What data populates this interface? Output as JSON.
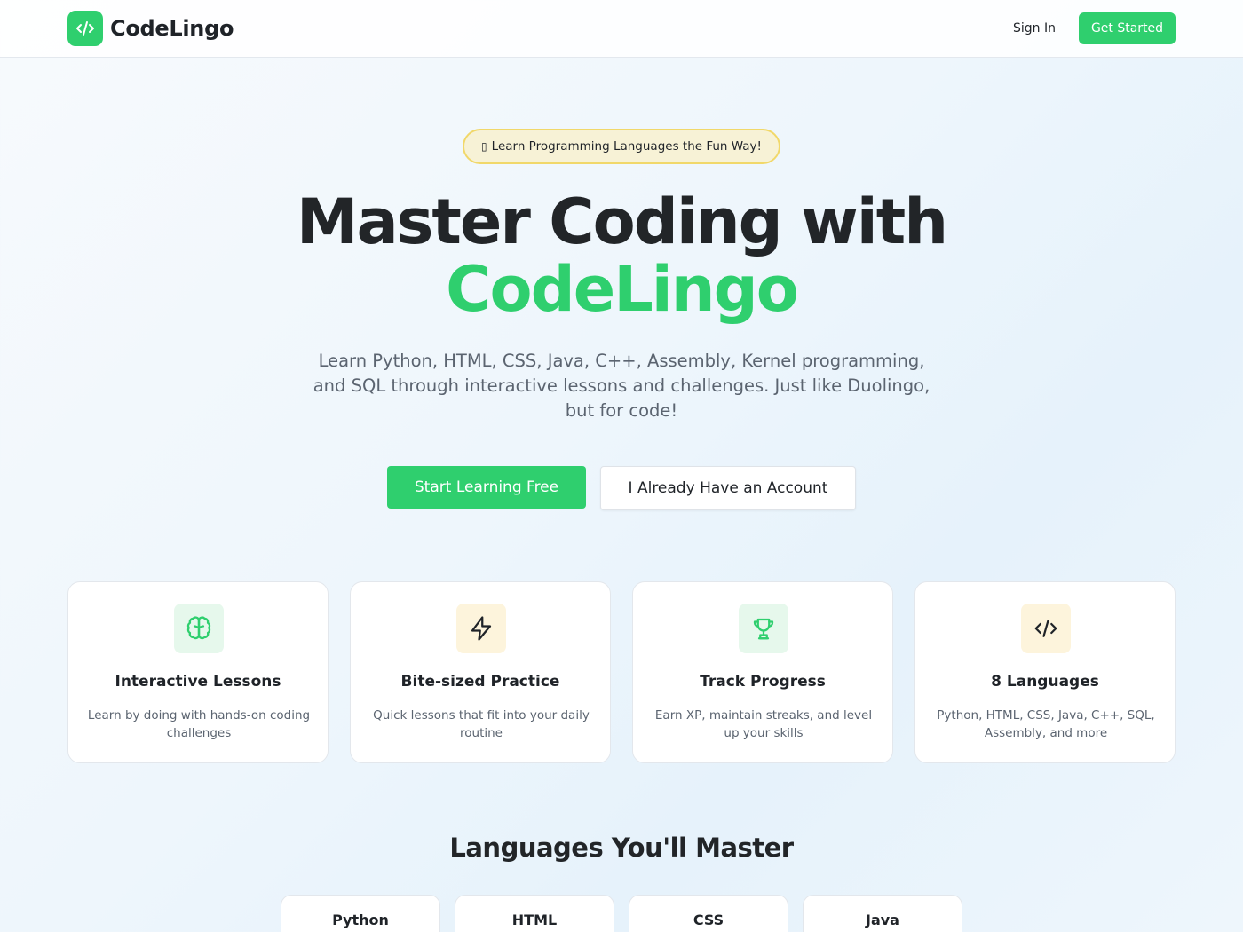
{
  "header": {
    "brand_name": "CodeLingo",
    "sign_in_label": "Sign In",
    "get_started_label": "Get Started"
  },
  "hero": {
    "badge_glyph": "▯",
    "badge_text": "Learn Programming Languages the Fun Way!",
    "title_line1": "Master Coding with",
    "title_line2": "CodeLingo",
    "subtitle": "Learn Python, HTML, CSS, Java, C++, Assembly, Kernel programming, and SQL through interactive lessons and challenges. Just like Duolingo, but for code!",
    "primary_cta": "Start Learning Free",
    "secondary_cta": "I Already Have an Account"
  },
  "features": [
    {
      "icon": "brain-icon",
      "title": "Interactive Lessons",
      "desc": "Learn by doing with hands-on coding challenges"
    },
    {
      "icon": "lightning-icon",
      "title": "Bite-sized Practice",
      "desc": "Quick lessons that fit into your daily routine"
    },
    {
      "icon": "trophy-icon",
      "title": "Track Progress",
      "desc": "Earn XP, maintain streaks, and level up your skills"
    },
    {
      "icon": "code-icon",
      "title": "8 Languages",
      "desc": "Python, HTML, CSS, Java, C++, SQL, Assembly, and more"
    }
  ],
  "languages_section": {
    "title": "Languages You'll Master",
    "items": [
      "Python",
      "HTML",
      "CSS",
      "Java"
    ]
  },
  "colors": {
    "brand_green": "#2fcf6e",
    "badge_border": "#f1d86a",
    "badge_bg": "#f7f2d6",
    "text_dark": "#222528",
    "text_muted": "#5b6470"
  }
}
